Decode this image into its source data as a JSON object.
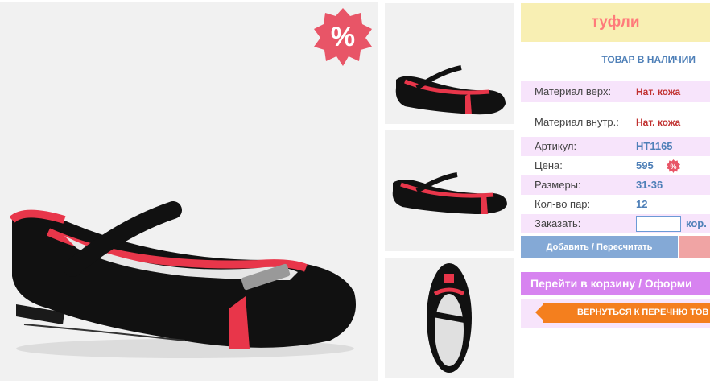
{
  "product": {
    "title": "туфли",
    "stock_status": "ТОВАР В НАЛИЧИИ"
  },
  "sale_badge": {
    "symbol": "%",
    "icon": "percent-sale-badge-icon"
  },
  "details": [
    {
      "label": "Материал верх:",
      "value": "Нат. кожа",
      "style": "red"
    },
    {
      "label": "Материал внутр.:",
      "value": "Нат. кожа",
      "style": "red"
    },
    {
      "label": "Артикул:",
      "value": "HT1165",
      "style": "blue"
    },
    {
      "label": "Цена:",
      "value": "595",
      "style": "blue"
    },
    {
      "label": "Размеры:",
      "value": "31-36",
      "style": "blue"
    },
    {
      "label": "Кол-во пар:",
      "value": "12",
      "style": "blue"
    }
  ],
  "order": {
    "label": "Заказать:",
    "quantity_value": "",
    "unit": "кор."
  },
  "buttons": {
    "add_recalc": "Добавить / Пересчитать",
    "go_to_cart": "Перейти в корзину / Оформи",
    "back_to_list": "ВЕРНУТЬСЯ К ПЕРЕЧНЮ ТОВ"
  },
  "colors": {
    "title_bg": "#f8efb3",
    "title_text": "#ff7b7b",
    "row_bg": "#f7e4fb",
    "link_blue": "#4f80b8",
    "value_red": "#c0302f",
    "add_button": "#84a9d6",
    "cart_button": "#d783f0",
    "back_button": "#f47f1e"
  }
}
